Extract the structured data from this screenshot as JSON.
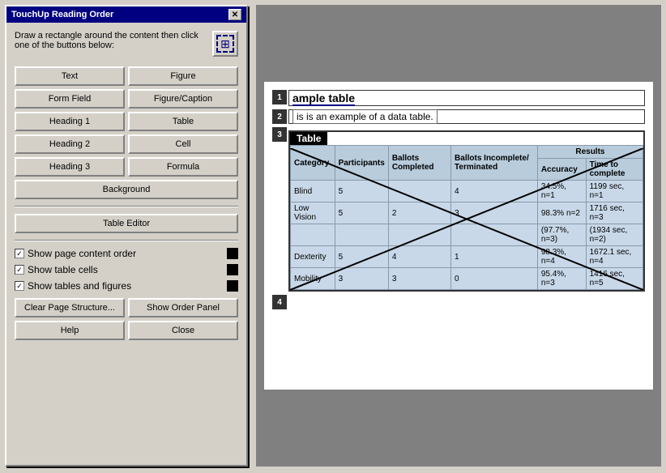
{
  "dialog": {
    "title": "TouchUp Reading Order",
    "close_label": "✕",
    "instruction": "Draw a rectangle around the content then click one of the buttons below:",
    "buttons": {
      "text": "Text",
      "figure": "Figure",
      "form_field": "Form Field",
      "figure_caption": "Figure/Caption",
      "heading1": "Heading 1",
      "table": "Table",
      "heading2": "Heading 2",
      "cell": "Cell",
      "heading3": "Heading 3",
      "formula": "Formula",
      "background": "Background",
      "table_editor": "Table Editor"
    },
    "checkboxes": {
      "show_page_order": "Show page content order",
      "show_table_cells": "Show table cells",
      "show_tables_figures": "Show tables and figures"
    },
    "bottom_buttons": {
      "clear_page": "Clear Page Structure...",
      "show_order": "Show Order Panel",
      "help": "Help",
      "close": "Close"
    }
  },
  "pdf": {
    "order_tags": [
      "1",
      "2",
      "3",
      "4"
    ],
    "heading": "ample table",
    "body_text": "is is an example of a data table.",
    "table_label": "Table",
    "table": {
      "headers": {
        "results": "Results",
        "category": "Category",
        "participants": "Participants",
        "ballots_completed": "Ballots Completed",
        "ballots_incomplete": "Ballots Incomplete/ Terminated",
        "accuracy": "Accuracy",
        "time_to_complete": "Time to complete"
      },
      "rows": [
        {
          "category": "Blind",
          "participants": "5",
          "ballots_completed": "",
          "ballots_incomplete": "4",
          "accuracy": "34.5%, n=1",
          "time": "1199 sec, n=1"
        },
        {
          "category": "Low Vision",
          "participants": "5",
          "ballots_completed": "2",
          "ballots_incomplete": "3",
          "accuracy": "98.3% n=2",
          "time": "1716 sec, n=3"
        },
        {
          "category": "",
          "participants": "",
          "ballots_completed": "",
          "ballots_incomplete": "",
          "accuracy": "(97.7%, n=3)",
          "time": "(1934 sec, n=2)"
        },
        {
          "category": "Dexterity",
          "participants": "5",
          "ballots_completed": "4",
          "ballots_incomplete": "1",
          "accuracy": "98.3%, n=4",
          "time": "1672.1 sec, n=4"
        },
        {
          "category": "Mobility",
          "participants": "3",
          "ballots_completed": "3",
          "ballots_incomplete": "0",
          "accuracy": "95.4%, n=3",
          "time": "1416 sec, n=5"
        }
      ]
    }
  }
}
